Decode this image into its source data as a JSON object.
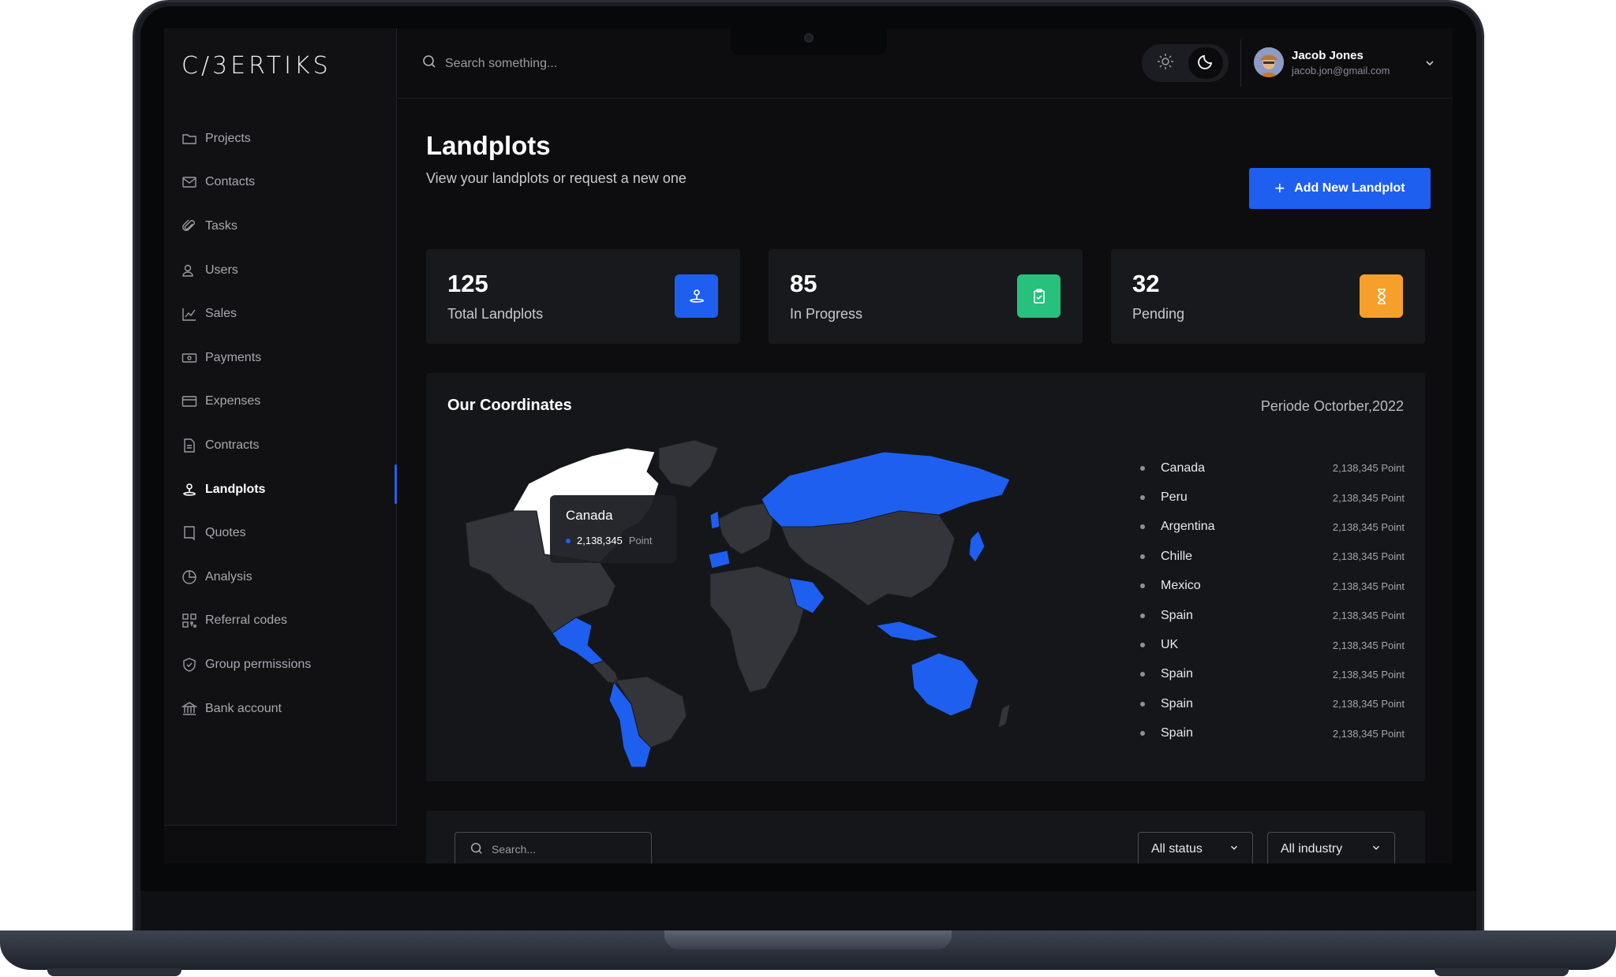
{
  "app": {
    "logo": "C/3ERTIKS"
  },
  "sidebar": {
    "items": [
      {
        "label": "Projects",
        "icon": "folder-icon"
      },
      {
        "label": "Contacts",
        "icon": "mail-icon"
      },
      {
        "label": "Tasks",
        "icon": "paperclip-icon"
      },
      {
        "label": "Users",
        "icon": "users-icon"
      },
      {
        "label": "Sales",
        "icon": "chart-line-icon"
      },
      {
        "label": "Payments",
        "icon": "cash-icon"
      },
      {
        "label": "Expenses",
        "icon": "credit-card-icon"
      },
      {
        "label": "Contracts",
        "icon": "document-icon"
      },
      {
        "label": "Landplots",
        "icon": "map-pin-icon",
        "active": true
      },
      {
        "label": "Quotes",
        "icon": "bookmark-icon"
      },
      {
        "label": "Analysis",
        "icon": "pie-chart-icon"
      },
      {
        "label": "Referral codes",
        "icon": "qr-code-icon"
      },
      {
        "label": "Group permissions",
        "icon": "shield-icon"
      },
      {
        "label": "Bank account",
        "icon": "bank-icon"
      }
    ]
  },
  "topbar": {
    "search_placeholder": "Search something...",
    "theme_mode": "dark",
    "user": {
      "name": "Jacob Jones",
      "email": "jacob.jon@gmail.com"
    }
  },
  "page": {
    "title": "Landplots",
    "subtitle": "View your landplots or request a new one",
    "add_button": "Add New Landplot"
  },
  "stats": [
    {
      "value": "125",
      "label": "Total Landplots",
      "color": "#1e5ff0",
      "icon": "map-pin-icon"
    },
    {
      "value": "85",
      "label": "In Progress",
      "color": "#27c07d",
      "icon": "clipboard-check-icon"
    },
    {
      "value": "32",
      "label": "Pending",
      "color": "#f5a02a",
      "icon": "hourglass-icon"
    }
  ],
  "coordinates": {
    "title": "Our Coordinates",
    "period": "Periode Octorber,2022",
    "tooltip": {
      "country": "Canada",
      "value": "2,138,345",
      "unit": "Point"
    },
    "list": [
      {
        "country": "Canada",
        "value": "2,138,345 Point"
      },
      {
        "country": "Peru",
        "value": "2,138,345 Point"
      },
      {
        "country": "Argentina",
        "value": "2,138,345 Point"
      },
      {
        "country": "Chille",
        "value": "2,138,345 Point"
      },
      {
        "country": "Mexico",
        "value": "2,138,345 Point"
      },
      {
        "country": "Spain",
        "value": "2,138,345 Point"
      },
      {
        "country": "UK",
        "value": "2,138,345 Point"
      },
      {
        "country": "Spain",
        "value": "2,138,345 Point"
      },
      {
        "country": "Spain",
        "value": "2,138,345 Point"
      },
      {
        "country": "Spain",
        "value": "2,138,345 Point"
      }
    ],
    "colors": {
      "highlight": "#1e5ff0",
      "selected": "#ffffff",
      "land": "#34353b"
    }
  },
  "table": {
    "search_placeholder": "Search...",
    "status_filter": "All status",
    "industry_filter": "All industry"
  }
}
